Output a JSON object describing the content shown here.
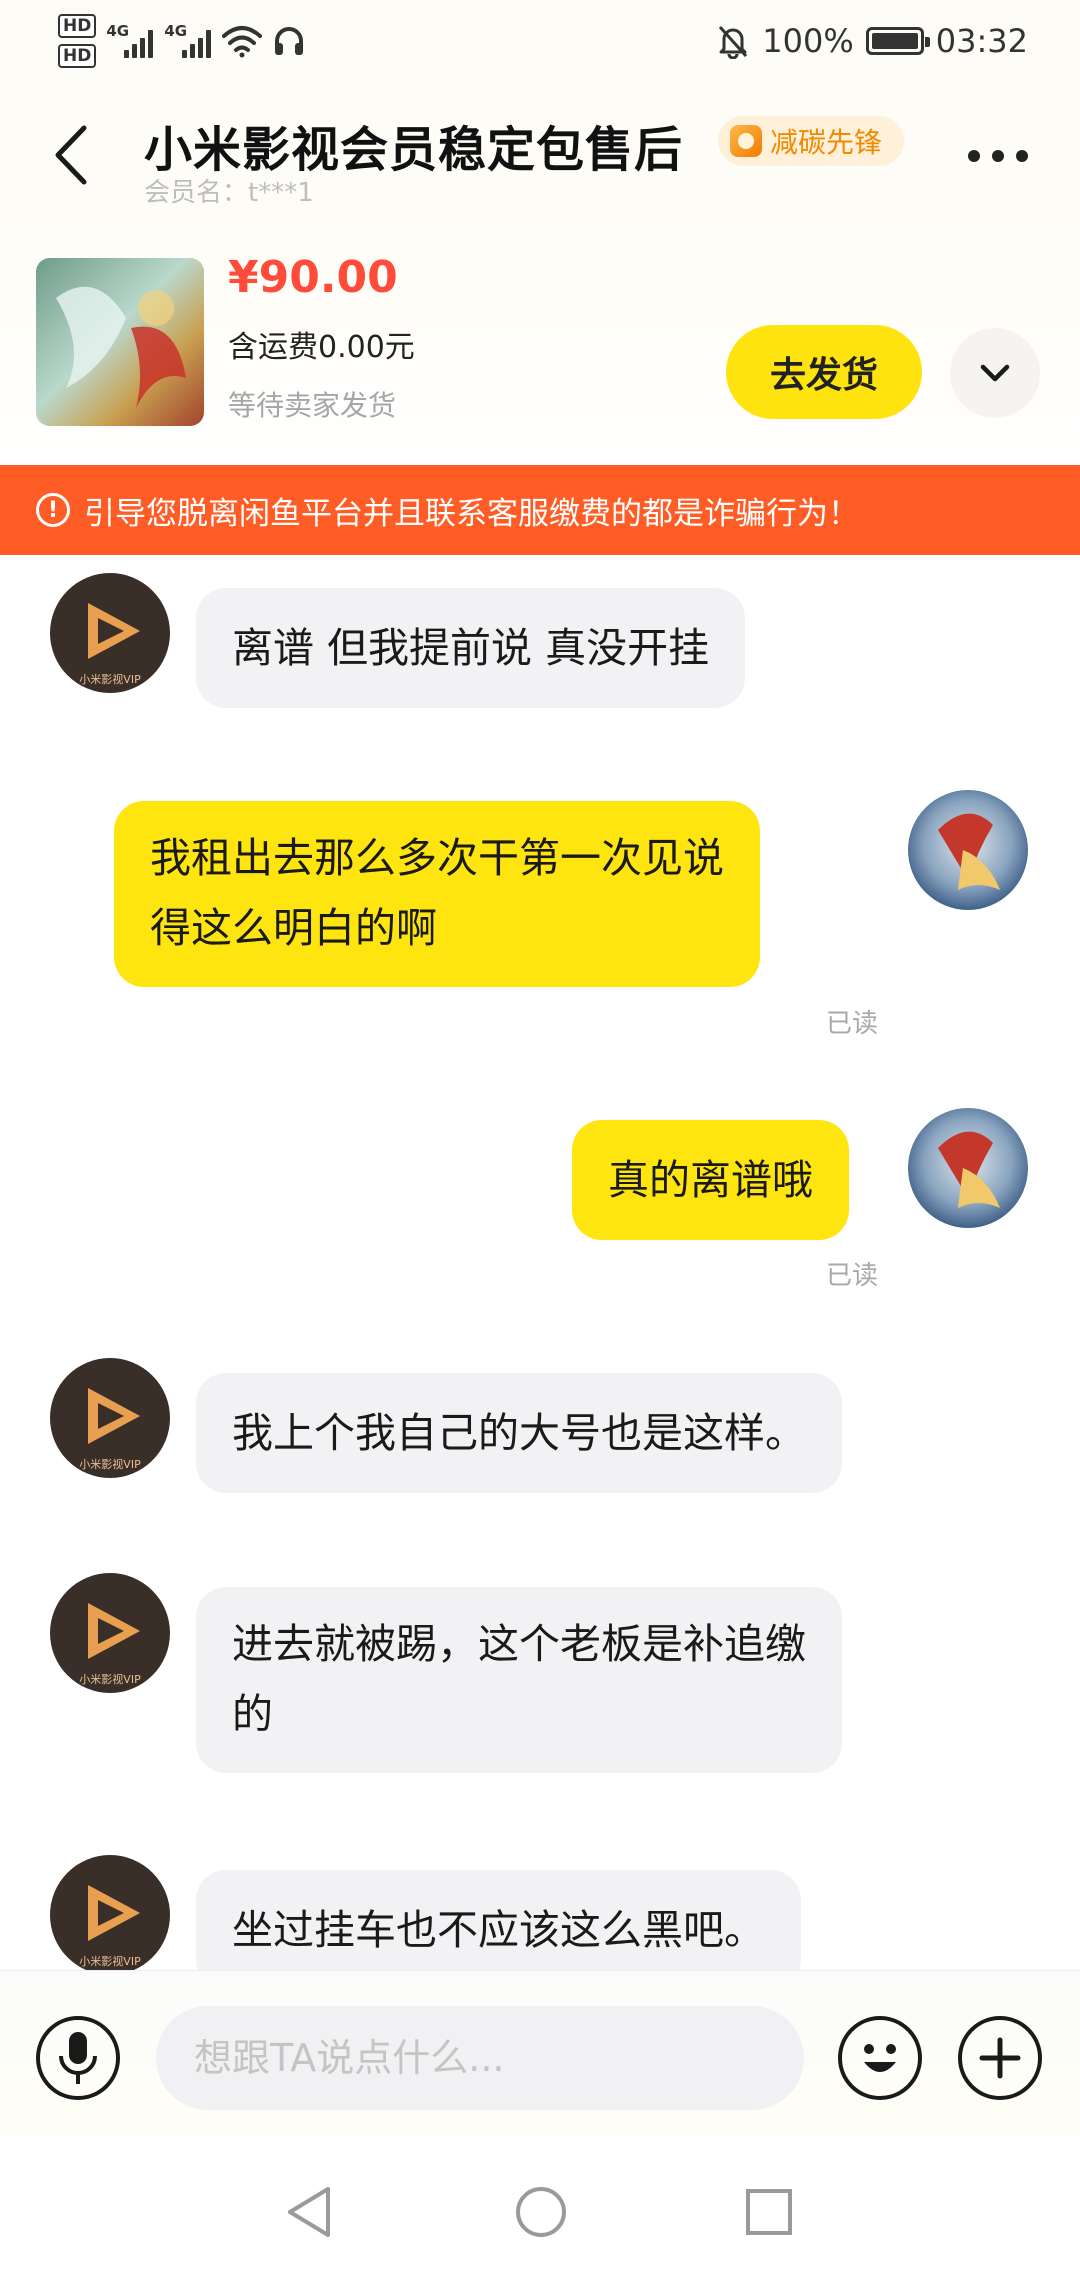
{
  "status_bar": {
    "hd1": "HD",
    "hd2": "HD",
    "network1": "4G",
    "network2": "4G",
    "battery": "100%",
    "time": "03:32",
    "icons": [
      "hd-icon",
      "signal-icon",
      "wifi-icon",
      "headset-icon",
      "mute-bell-icon",
      "battery-icon"
    ]
  },
  "header": {
    "title": "小米影视会员稳定包售后",
    "badge": "减碳先锋",
    "member_label": "会员名：t***1"
  },
  "product": {
    "price": "¥90.00",
    "shipping": "含运费0.00元",
    "status": "等待卖家发货",
    "ship_button": "去发货"
  },
  "warning": {
    "text": "引导您脱离闲鱼平台并且联系客服缴费的都是诈骗行为！",
    "icon": "!"
  },
  "messages": [
    {
      "side": "in",
      "text": "离谱 但我提前说 真没开挂",
      "avatar_text": "小米影视VIP"
    },
    {
      "side": "out",
      "lines": [
        "我租出去那么多次干第一次见说",
        "得这么明白的啊"
      ],
      "read": "已读"
    },
    {
      "side": "out",
      "text": "真的离谱哦",
      "read": "已读"
    },
    {
      "side": "in",
      "text": "我上个我自己的大号也是这样。",
      "avatar_text": "小米影视VIP"
    },
    {
      "side": "in",
      "lines": [
        "进去就被踢，这个老板是补追缴",
        "的"
      ],
      "avatar_text": "小米影视VIP"
    },
    {
      "side": "in",
      "text": "坐过挂车也不应该这么黑吧。",
      "avatar_text": "小米影视VIP"
    }
  ],
  "input": {
    "placeholder": "想跟TA说点什么..."
  },
  "colors": {
    "accent_yellow": "#ffe50f",
    "price_red": "#ff4b3a",
    "warning_orange": "#ff5c26",
    "incoming_bubble": "#f2f2f4"
  }
}
